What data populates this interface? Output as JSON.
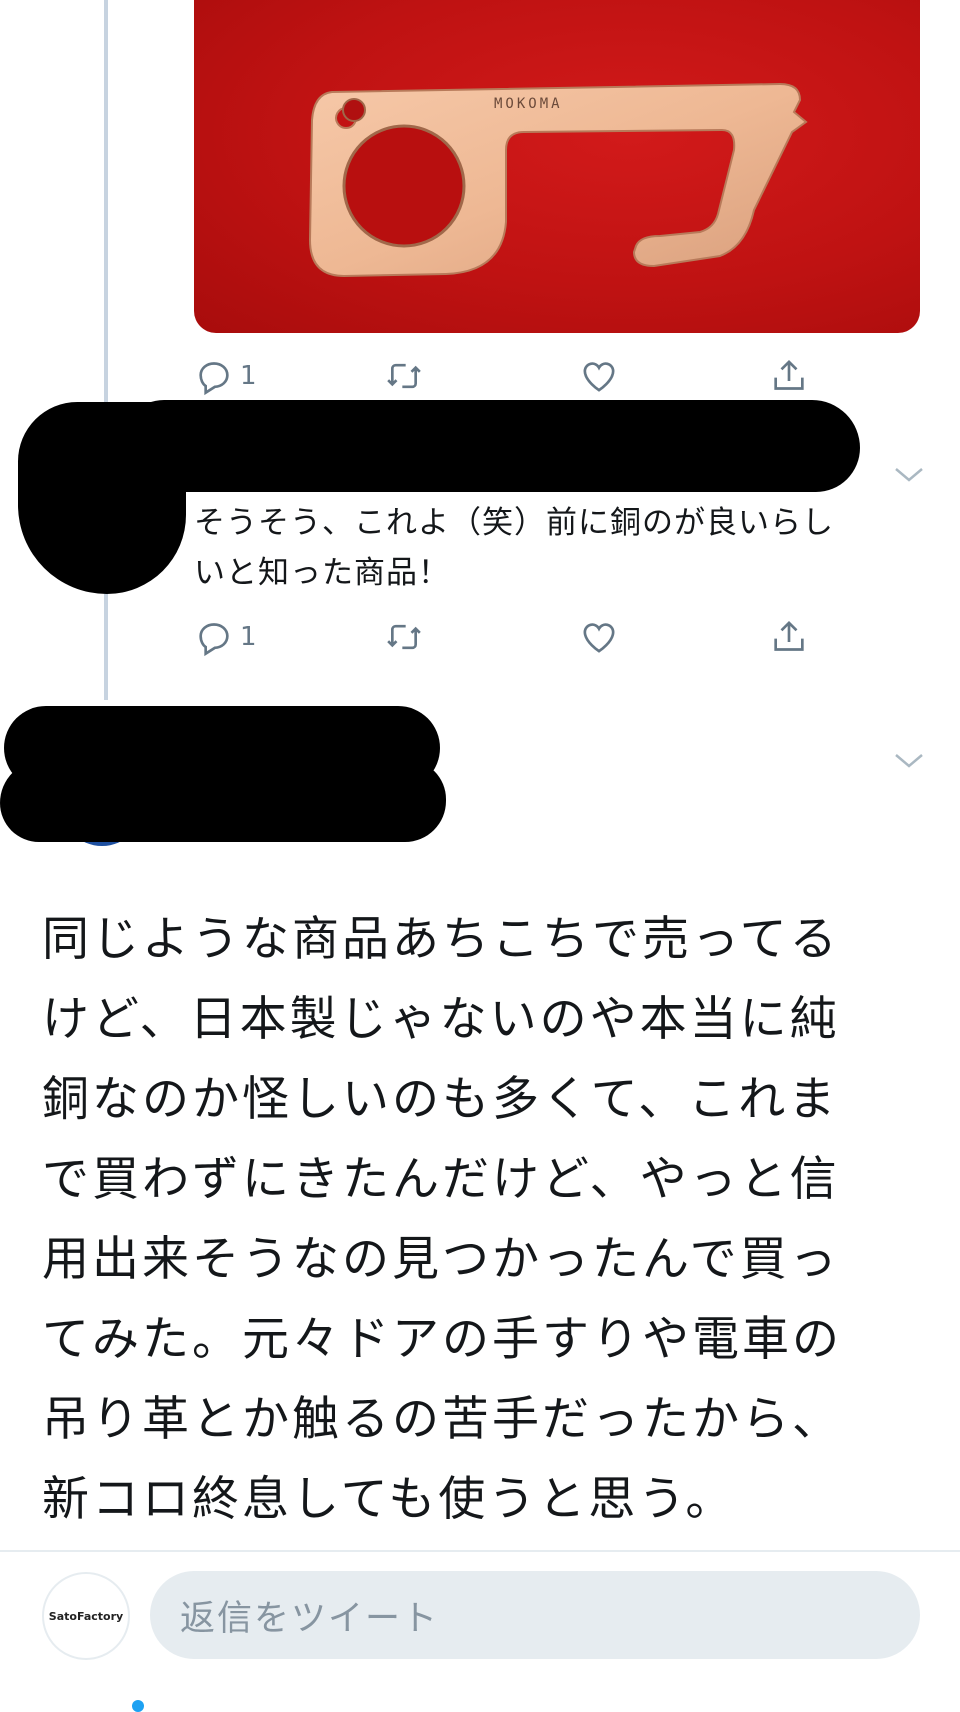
{
  "tweet_image": {
    "engraving": "MOKOMA"
  },
  "first_tweet_actions": {
    "reply_count": "1"
  },
  "reply_tweet": {
    "text_line1": "そうそう、これよ（笑）前に銅のが良いらし",
    "text_line2": "いと知った商品！",
    "reply_count": "1"
  },
  "main_tweet": {
    "lines": [
      "同じような商品あちこちで売ってる",
      "けど、日本製じゃないのや本当に純",
      "銅なのか怪しいのも多くて、これま",
      "で買わずにきたんだけど、やっと信",
      "用出来そうなの見つかったんで買っ",
      "てみた。元々ドアの手すりや電車の",
      "吊り革とか触るの苦手だったから、",
      "新コロ終息しても使うと思う。"
    ]
  },
  "composer": {
    "avatar_text": "SatoFactory",
    "placeholder": "返信をツイート"
  },
  "colors": {
    "icon_gray": "#657786",
    "thread_line": "#c7d3e0",
    "accent": "#1da1f2"
  },
  "icons": [
    "reply-icon",
    "retweet-icon",
    "like-icon",
    "share-icon",
    "chevron-down-icon"
  ]
}
